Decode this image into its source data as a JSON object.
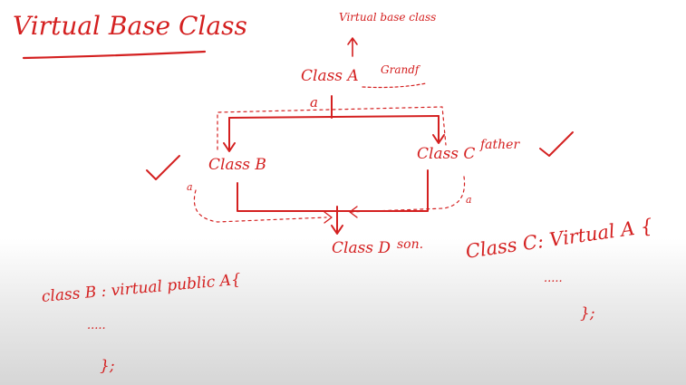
{
  "ink_color": "#d42020",
  "title": "Virtual Base Class",
  "note_virtual_base_class": "Virtual base class",
  "class_a": "Class A",
  "class_a_role": "Grandf",
  "class_b": "Class B",
  "class_c": "Class C",
  "class_c_role": "father",
  "class_d": "Class D",
  "class_d_role": "son.",
  "member_a": "a",
  "code_b_line1": "class B : virtual public A{",
  "code_b_line2": ".....",
  "code_b_line3": "};",
  "code_c_line1": "Class C: Virtual A {",
  "code_c_line2": ".....",
  "code_c_line3": "};"
}
